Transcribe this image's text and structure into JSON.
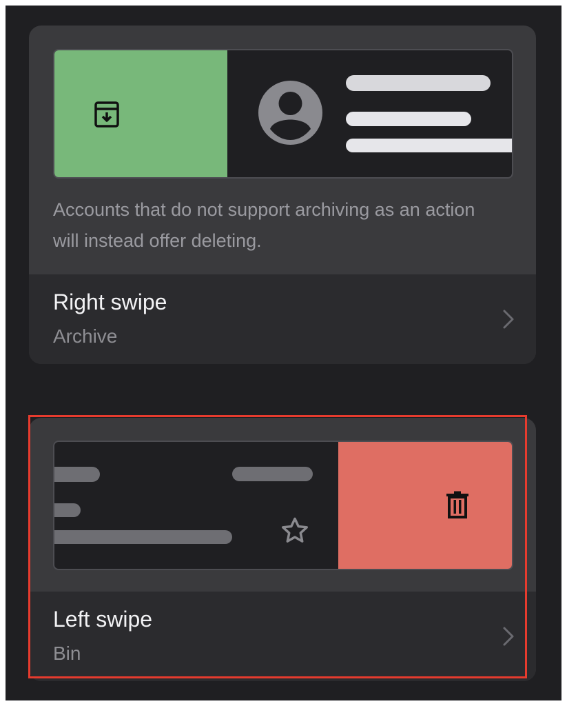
{
  "right_swipe": {
    "note": "Accounts that do not support archiving as an action will instead offer deleting.",
    "title": "Right swipe",
    "value": "Archive",
    "action_icon": "archive-icon",
    "accent": "#78b87a"
  },
  "left_swipe": {
    "title": "Left swipe",
    "value": "Bin",
    "action_icon": "trash-icon",
    "accent": "#df6e63"
  },
  "colors": {
    "background": "#1f1f22",
    "card": "#3a3a3d",
    "row": "#2b2b2e",
    "highlight": "#e63b2e"
  }
}
